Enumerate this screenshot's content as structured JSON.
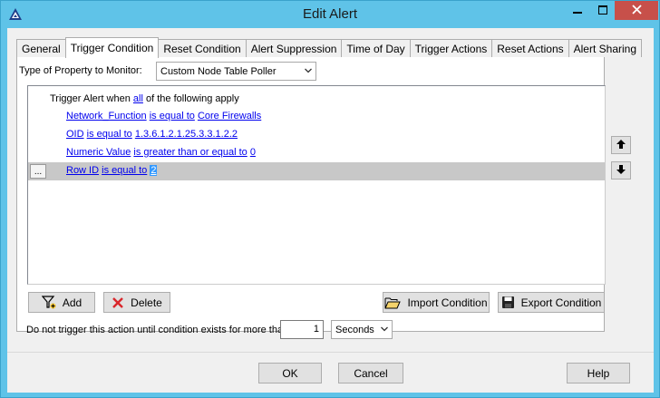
{
  "window": {
    "title": "Edit Alert",
    "icon": "solarwinds-logo-icon"
  },
  "tabs": [
    {
      "label": "General",
      "active": false
    },
    {
      "label": "Trigger Condition",
      "active": true
    },
    {
      "label": "Reset Condition",
      "active": false
    },
    {
      "label": "Alert Suppression",
      "active": false
    },
    {
      "label": "Time of Day",
      "active": false
    },
    {
      "label": "Trigger Actions",
      "active": false
    },
    {
      "label": "Reset Actions",
      "active": false
    },
    {
      "label": "Alert Sharing",
      "active": false
    }
  ],
  "property": {
    "label": "Type of Property to Monitor:",
    "value": "Custom Node Table Poller"
  },
  "condition_header": {
    "prefix": "Trigger Alert when",
    "quantifier": "all",
    "suffix": "of the following apply"
  },
  "conditions": [
    {
      "field": "Network_Function",
      "operator": "is equal to",
      "value": "Core Firewalls",
      "selected": false
    },
    {
      "field": "OID",
      "operator": "is equal to",
      "value": "1.3.6.1.2.1.25.3.3.1.2.2",
      "selected": false
    },
    {
      "field": "Numeric Value",
      "operator": "is greater than or equal to",
      "value": "0",
      "selected": false
    },
    {
      "field": "Row ID",
      "operator": "is equal to",
      "value": "2",
      "selected": true
    }
  ],
  "row_menu_label": "...",
  "buttons": {
    "add": "Add",
    "delete": "Delete",
    "import": "Import Condition",
    "export": "Export Condition",
    "ok": "OK",
    "cancel": "Cancel",
    "help": "Help"
  },
  "delay": {
    "label": "Do not trigger this action until condition exists for more than",
    "value": "1",
    "unit": "Seconds"
  },
  "colors": {
    "title_bar": "#5fc3e8",
    "link": "#0000ee",
    "selected_row": "#c8c8c8",
    "close_button": "#c7504a"
  }
}
